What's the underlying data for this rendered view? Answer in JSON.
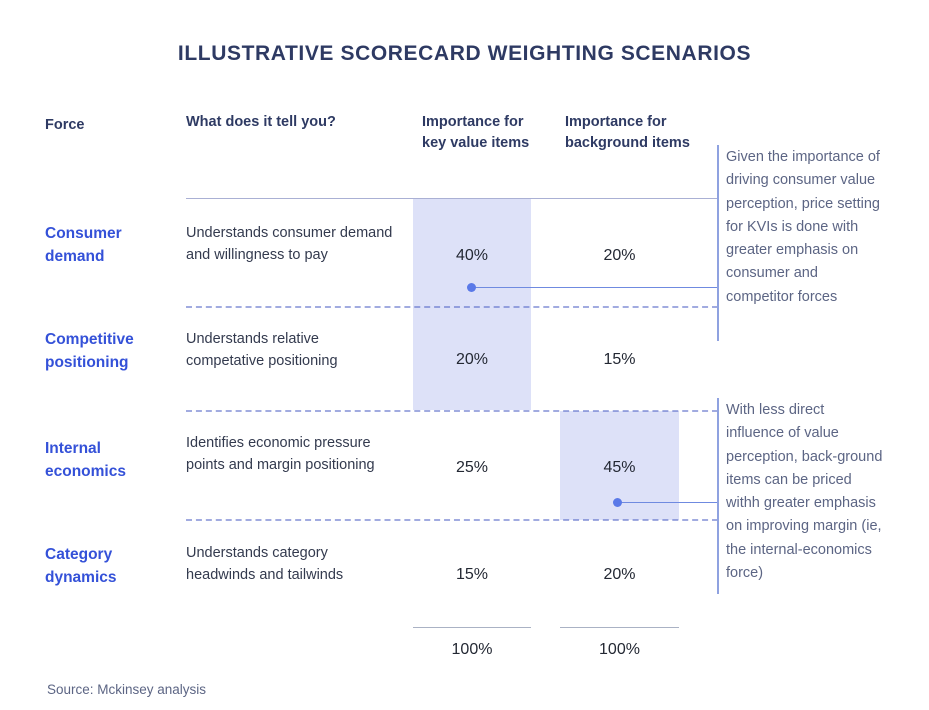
{
  "title": "ILLUSTRATIVE SCORECARD WEIGHTING SCENARIOS",
  "source": "Source: Mckinsey analysis",
  "colors": {
    "title": "#2e3a63",
    "force_label": "#3451d8",
    "highlight_band": "#dde1f8",
    "connector": "#5a79e8",
    "annotation_text": "#5c6584",
    "annotation_bar": "#8fa2e0",
    "dashed_rule": "#5568c8"
  },
  "table": {
    "headers": {
      "force": "Force",
      "what": "What does it tell you?",
      "kvi": "Importance for key value items",
      "background": "Importance for background items"
    },
    "rows": [
      {
        "force": "Consumer demand",
        "description": "Understands consumer demand and willingness to pay",
        "kvi": "40%",
        "background": "20%"
      },
      {
        "force": "Competitive positioning",
        "description": "Understands relative competative positioning",
        "kvi": "20%",
        "background": "15%"
      },
      {
        "force": "Internal economics",
        "description": "Identifies economic pressure points and margin positioning",
        "kvi": "25%",
        "background": "45%"
      },
      {
        "force": "Category dynamics",
        "description": "Understands category headwinds and tailwinds",
        "kvi": "15%",
        "background": "20%"
      }
    ],
    "totals": {
      "kvi": "100%",
      "background": "100%"
    }
  },
  "annotations": [
    {
      "text": "Given the importance of driving consumer value perception, price setting for KVIs is done with greater emphasis on consumer and competitor forces"
    },
    {
      "text": "With less direct influence of value perception, back-ground items can be priced withh greater emphasis on improving margin (ie, the internal-economics force)"
    }
  ]
}
